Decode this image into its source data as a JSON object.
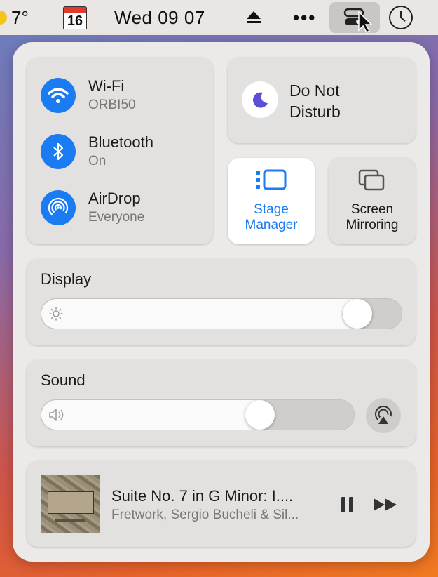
{
  "menubar": {
    "temperature": "7°",
    "calendar_day": "16",
    "datetime": "Wed 09  07",
    "more": "•••",
    "icons": [
      "weather-sun-icon",
      "calendar-icon",
      "eject-icon",
      "more-dots-icon",
      "control-center-icon",
      "clock-icon"
    ]
  },
  "connectivity": {
    "wifi": {
      "title": "Wi-Fi",
      "subtitle": "ORBI50"
    },
    "bluetooth": {
      "title": "Bluetooth",
      "subtitle": "On"
    },
    "airdrop": {
      "title": "AirDrop",
      "subtitle": "Everyone"
    }
  },
  "focus": {
    "label_line1": "Do Not",
    "label_line2": "Disturb"
  },
  "stage_manager": {
    "label_line1": "Stage",
    "label_line2": "Manager",
    "active": true
  },
  "screen_mirroring": {
    "label_line1": "Screen",
    "label_line2": "Mirroring"
  },
  "display": {
    "title": "Display",
    "brightness": 0.91
  },
  "sound": {
    "title": "Sound",
    "volume": 0.72
  },
  "now_playing": {
    "title": "Suite No. 7 in G Minor: I....",
    "artist": "Fretwork, Sergio Bucheli & Sil..."
  },
  "colors": {
    "accent": "#1b7bf2",
    "moon": "#5b50d6"
  }
}
